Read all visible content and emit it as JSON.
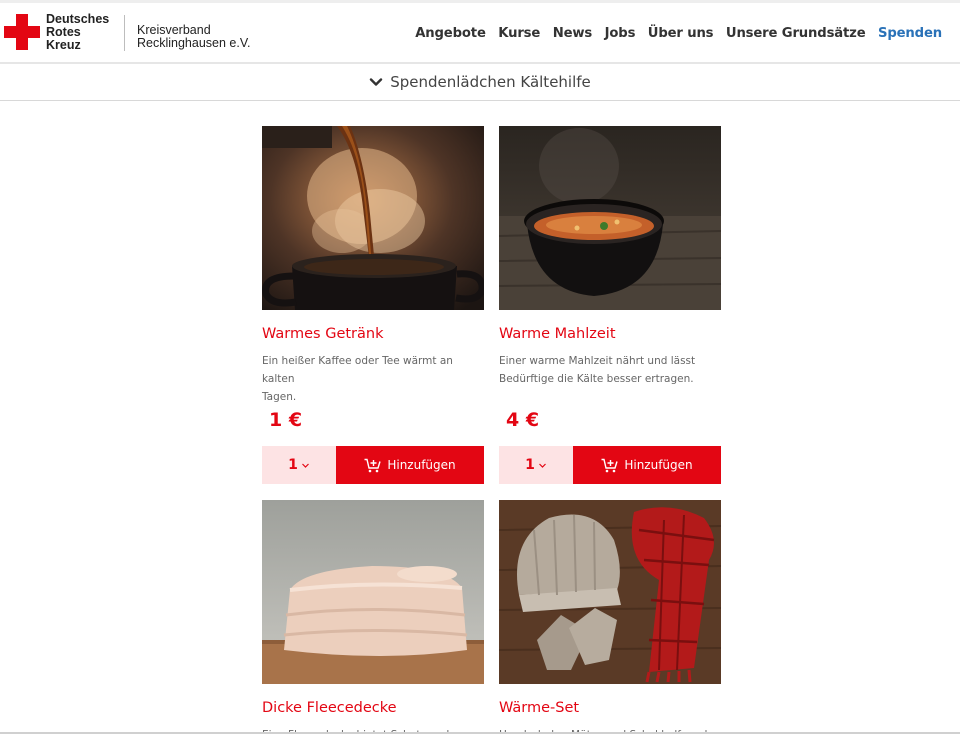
{
  "header": {
    "logo": {
      "lines": [
        "Deutsches",
        "Rotes",
        "Kreuz"
      ],
      "org_lines": [
        "Kreisverband",
        "Recklinghausen e.V."
      ],
      "cross_color": "#e30613"
    },
    "nav": [
      {
        "label": "Angebote"
      },
      {
        "label": "Kurse"
      },
      {
        "label": "News"
      },
      {
        "label": "Jobs"
      },
      {
        "label": "Über uns"
      },
      {
        "label": "Unsere Grundsätze"
      },
      {
        "label": "Spenden",
        "color": "#2a72b8"
      }
    ]
  },
  "category": {
    "icon": "chevron-down-icon",
    "label": "Spendenlädchen Kältehilfe"
  },
  "products": [
    {
      "title": "Warmes Getränk",
      "desc_lines": [
        "Ein heißer Kaffee oder Tee wärmt an kalten",
        "Tagen."
      ],
      "price": "1 €",
      "qty": "1",
      "add_label": "Hinzufügen",
      "image_icon": "hot-drink-image"
    },
    {
      "title": "Warme Mahlzeit",
      "desc_lines": [
        "Einer warme Mahlzeit nährt und lässt",
        "Bedürftige die Kälte besser ertragen."
      ],
      "price": "4 €",
      "qty": "1",
      "add_label": "Hinzufügen",
      "image_icon": "soup-bowl-image"
    },
    {
      "title": "Dicke Fleecedecke",
      "desc_lines": [
        "Eine Fleecedecke bietet Schutz und Wärme"
      ],
      "image_icon": "blanket-image"
    },
    {
      "title": "Wärme-Set",
      "desc_lines": [
        "Handschuhe, Mütze und Schal helfen, den"
      ],
      "image_icon": "winter-set-image"
    }
  ],
  "colors": {
    "accent": "#e30613",
    "qty_bg": "#fde3e4",
    "link_blue": "#2a72b8"
  }
}
